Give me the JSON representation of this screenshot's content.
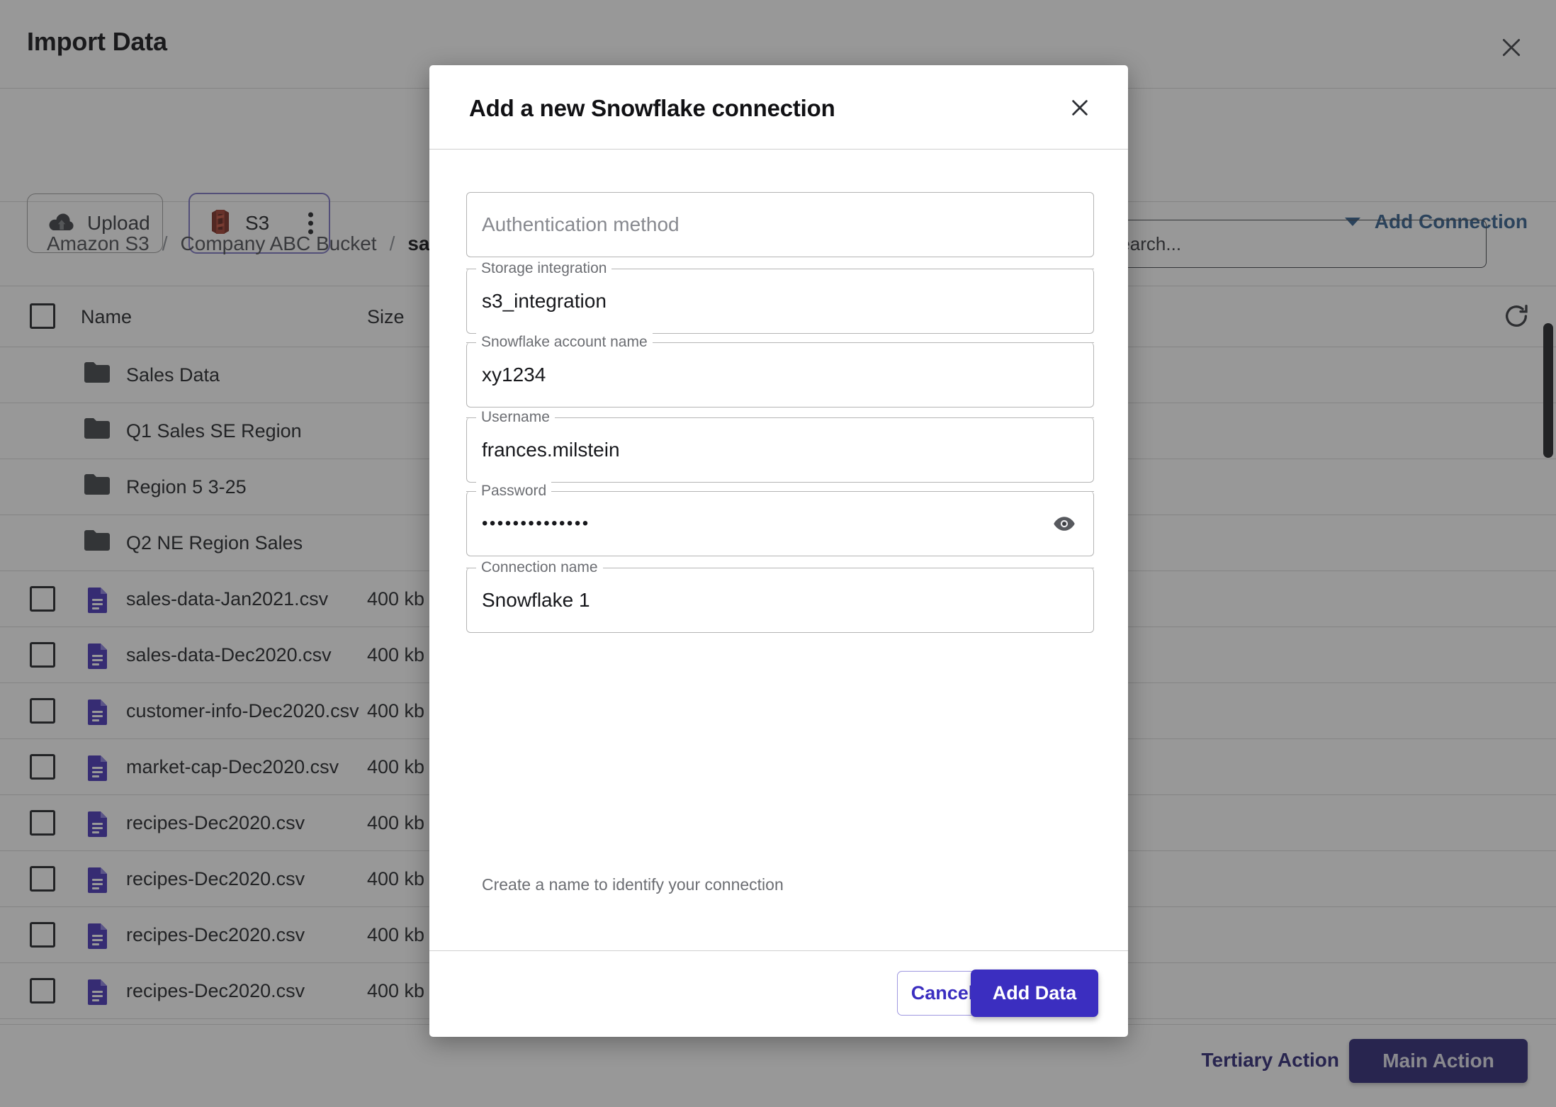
{
  "page": {
    "title": "Import Data",
    "close_icon": "close-icon",
    "toolbar": {
      "upload_label": "Upload",
      "upload_icon": "cloud-upload-icon",
      "s3_label": "S3",
      "s3_icon": "s3-bucket-icon",
      "s3_menu_icon": "kebab-menu-icon",
      "add_connection_label": "Add Connection",
      "add_connection_caret_icon": "chevron-down-icon"
    },
    "breadcrumb": {
      "items": [
        "Amazon S3",
        "Company ABC Bucket",
        "sales-d"
      ],
      "separator": "/"
    },
    "search": {
      "placeholder": "Search...",
      "visible_text": "ch..."
    },
    "table": {
      "select_all_checkbox": "select-all-checkbox",
      "columns": [
        "Name",
        "Size"
      ],
      "refresh_icon": "refresh-icon",
      "rows": [
        {
          "type": "folder",
          "name": "Sales Data",
          "size": ""
        },
        {
          "type": "folder",
          "name": "Q1 Sales SE Region",
          "size": ""
        },
        {
          "type": "folder",
          "name": "Region 5 3-25",
          "size": ""
        },
        {
          "type": "folder",
          "name": "Q2 NE Region Sales",
          "size": ""
        },
        {
          "type": "file",
          "name": "sales-data-Jan2021.csv",
          "size": "400 kb"
        },
        {
          "type": "file",
          "name": "sales-data-Dec2020.csv",
          "size": "400 kb"
        },
        {
          "type": "file",
          "name": "customer-info-Dec2020.csv",
          "size": "400 kb"
        },
        {
          "type": "file",
          "name": "market-cap-Dec2020.csv",
          "size": "400 kb"
        },
        {
          "type": "file",
          "name": "recipes-Dec2020.csv",
          "size": "400 kb"
        },
        {
          "type": "file",
          "name": "recipes-Dec2020.csv",
          "size": "400 kb"
        },
        {
          "type": "file",
          "name": "recipes-Dec2020.csv",
          "size": "400 kb"
        },
        {
          "type": "file",
          "name": "recipes-Dec2020.csv",
          "size": "400 kb"
        }
      ]
    },
    "bottom_bar": {
      "tertiary_label": "Tertiary Action",
      "main_label": "Main Action"
    }
  },
  "modal": {
    "title": "Add a new Snowflake connection",
    "close_icon": "close-icon",
    "fields": [
      {
        "label": "",
        "placeholder": "Authentication method",
        "value": "",
        "notched": false,
        "name": "authentication-method-field"
      },
      {
        "label": "Storage integration",
        "placeholder": "",
        "value": "s3_integration",
        "notched": true,
        "name": "storage-integration-field"
      },
      {
        "label": "Snowflake account name",
        "placeholder": "",
        "value": "xy1234",
        "notched": true,
        "name": "snowflake-account-name-field"
      },
      {
        "label": "Username",
        "placeholder": "",
        "value": "frances.milstein",
        "notched": true,
        "name": "username-field"
      },
      {
        "label": "Password",
        "placeholder": "",
        "value": "••••••••••••••",
        "notched": true,
        "name": "password-field"
      },
      {
        "label": "Connection name",
        "placeholder": "",
        "value": "Snowflake 1",
        "notched": true,
        "name": "connection-name-field"
      }
    ],
    "password_toggle_icon": "eye-icon",
    "helper_text": "Create a name to identify your connection",
    "footer": {
      "cancel_label": "Cancel",
      "submit_label": "Add Data"
    }
  },
  "colors": {
    "primary_purple": "#3b2ec0",
    "dark_purple": "#2a2374",
    "link_blue": "#2f5d8c",
    "s3_red": "#8c2e23",
    "file_icon_purple": "#4431b8",
    "overlay": "rgba(40,40,40,0.48)"
  }
}
